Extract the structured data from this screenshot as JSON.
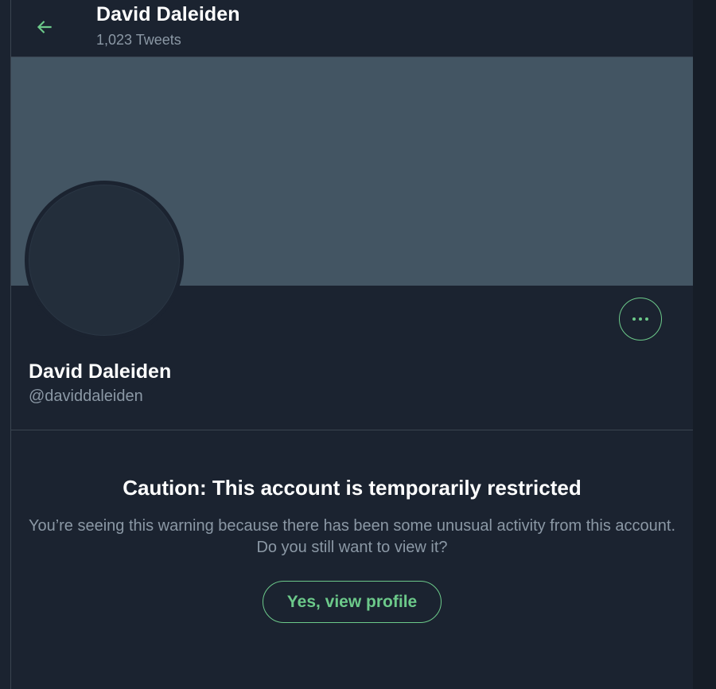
{
  "header": {
    "title": "David Daleiden",
    "subtitle": "1,023 Tweets"
  },
  "profile": {
    "name": "David Daleiden",
    "handle": "@daviddaleiden"
  },
  "warning": {
    "title": "Caution: This account is temporarily restricted",
    "message": "You’re seeing this warning because there has been some unusual activity from this account. Do you still want to view it?",
    "button_label": "Yes, view profile"
  },
  "icons": {
    "back": "back-arrow-icon",
    "more": "more-horizontal-icon"
  },
  "colors": {
    "background": "#1b2330",
    "banner": "#435563",
    "accent": "#6cc98a",
    "muted_text": "#8b98a5",
    "border": "#3a4450"
  }
}
